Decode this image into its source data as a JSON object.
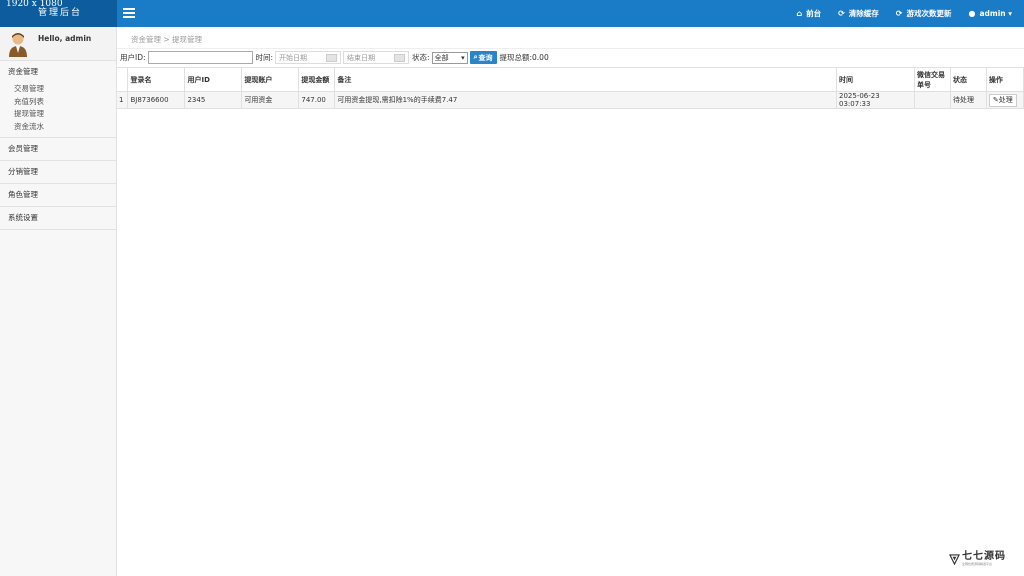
{
  "brand": {
    "resolution": "1920 x 1080",
    "title": "管理后台"
  },
  "topnav": [
    {
      "icon": "home-icon",
      "glyph": "⌂",
      "label": "前台"
    },
    {
      "icon": "refresh-icon",
      "glyph": "⟳",
      "label": "清除缓存"
    },
    {
      "icon": "refresh-icon",
      "glyph": "⟳",
      "label": "游戏次数更新"
    },
    {
      "icon": "user-icon",
      "glyph": "●",
      "label": "admin ▾"
    }
  ],
  "user": {
    "greeting": "Hello, admin"
  },
  "sidebar": {
    "sections": [
      {
        "label": "资金管理",
        "items": [
          "交易管理",
          "充值列表",
          "提现管理",
          "资金流水"
        ]
      },
      {
        "label": "会员管理"
      },
      {
        "label": "分销管理"
      },
      {
        "label": "角色管理"
      },
      {
        "label": "系统设置"
      }
    ]
  },
  "breadcrumb": "资金管理 > 提现管理",
  "filter": {
    "user_id_label": "用户ID:",
    "time_label": "时间:",
    "start_placeholder": "开始日期",
    "end_placeholder": "结束日期",
    "status_label": "状态:",
    "status_value": "全部",
    "search_label": "查询",
    "total_text": "提现总额:0.00"
  },
  "table": {
    "headers": [
      "登录名",
      "用户ID",
      "提现账户",
      "提现金额",
      "备注",
      "时间",
      "微信交易单号",
      "状态",
      "操作"
    ],
    "rows": [
      {
        "index": "1",
        "login": "BJ8736600",
        "user_id": "2345",
        "account": "可用资金",
        "amount": "747.00",
        "note": "可用资金提现,需扣除1%的手续费7.47",
        "time": "2025-06-23 03:07:33",
        "wx_no": "",
        "status": "待处理",
        "action": "处理"
      }
    ]
  },
  "watermark": {
    "text": "七七源码",
    "sub": "全网优质源码精选平台"
  }
}
